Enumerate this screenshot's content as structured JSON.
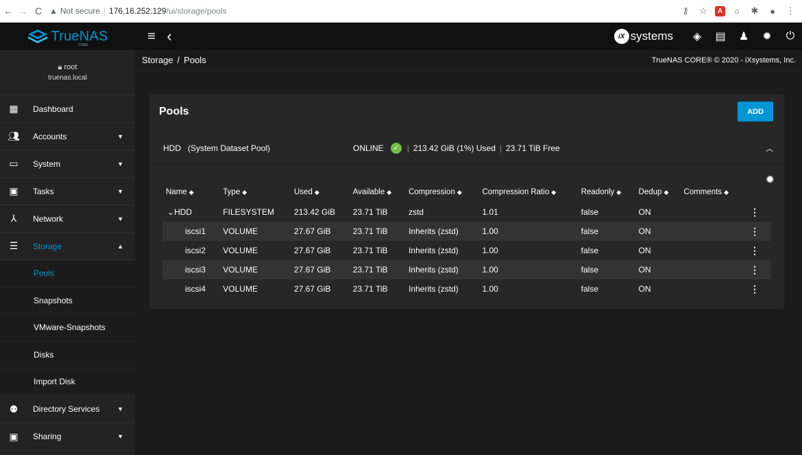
{
  "browser": {
    "back": "←",
    "forward": "→",
    "reload": "C",
    "warning_icon": "▲",
    "not_secure": "Not secure",
    "host": "176.16.252.129",
    "path": "/ui/storage/pools"
  },
  "topbar": {
    "logo_text": "TrueNAS",
    "logo_sub": "CORE",
    "menu_icon": "≡",
    "back_icon": "‹",
    "brand": "systems",
    "brand_mark": "iX"
  },
  "sidebar": {
    "user": "root",
    "host": "truenas.local",
    "items": [
      {
        "label": "Dashboard"
      },
      {
        "label": "Accounts"
      },
      {
        "label": "System"
      },
      {
        "label": "Tasks"
      },
      {
        "label": "Network"
      },
      {
        "label": "Storage"
      },
      {
        "label": "Directory Services"
      },
      {
        "label": "Sharing"
      }
    ],
    "storage_sub": [
      {
        "label": "Pools"
      },
      {
        "label": "Snapshots"
      },
      {
        "label": "VMware-Snapshots"
      },
      {
        "label": "Disks"
      },
      {
        "label": "Import Disk"
      }
    ]
  },
  "breadcrumb": {
    "section": "Storage",
    "page": "Pools"
  },
  "copyright": "TrueNAS CORE® © 2020 - iXsystems, Inc.",
  "card": {
    "title": "Pools",
    "add_label": "ADD"
  },
  "pool": {
    "name": "HDD",
    "role": "(System Dataset Pool)",
    "status": "ONLINE",
    "used": "213.42 GiB (1%) Used",
    "free": "23.71 TiB Free"
  },
  "table": {
    "columns": [
      "Name",
      "Type",
      "Used",
      "Available",
      "Compression",
      "Compression Ratio",
      "Readonly",
      "Dedup",
      "Comments"
    ],
    "rows": [
      {
        "name": "HDD",
        "type": "FILESYSTEM",
        "used": "213.42 GiB",
        "available": "23.71 TiB",
        "compression": "zstd",
        "ratio": "1.01",
        "readonly": "false",
        "dedup": "ON",
        "comments": ""
      },
      {
        "name": "iscsi1",
        "type": "VOLUME",
        "used": "27.67 GiB",
        "available": "23.71 TiB",
        "compression": "Inherits (zstd)",
        "ratio": "1.00",
        "readonly": "false",
        "dedup": "ON",
        "comments": ""
      },
      {
        "name": "iscsi2",
        "type": "VOLUME",
        "used": "27.67 GiB",
        "available": "23.71 TiB",
        "compression": "Inherits (zstd)",
        "ratio": "1.00",
        "readonly": "false",
        "dedup": "ON",
        "comments": ""
      },
      {
        "name": "iscsi3",
        "type": "VOLUME",
        "used": "27.67 GiB",
        "available": "23.71 TiB",
        "compression": "Inherits (zstd)",
        "ratio": "1.00",
        "readonly": "false",
        "dedup": "ON",
        "comments": ""
      },
      {
        "name": "iscsi4",
        "type": "VOLUME",
        "used": "27.67 GiB",
        "available": "23.71 TiB",
        "compression": "Inherits (zstd)",
        "ratio": "1.00",
        "readonly": "false",
        "dedup": "ON",
        "comments": ""
      }
    ]
  },
  "colors": {
    "accent": "#0095d5",
    "online": "#71bf44",
    "sidebar_bg": "#232323",
    "card_bg": "#272727"
  }
}
